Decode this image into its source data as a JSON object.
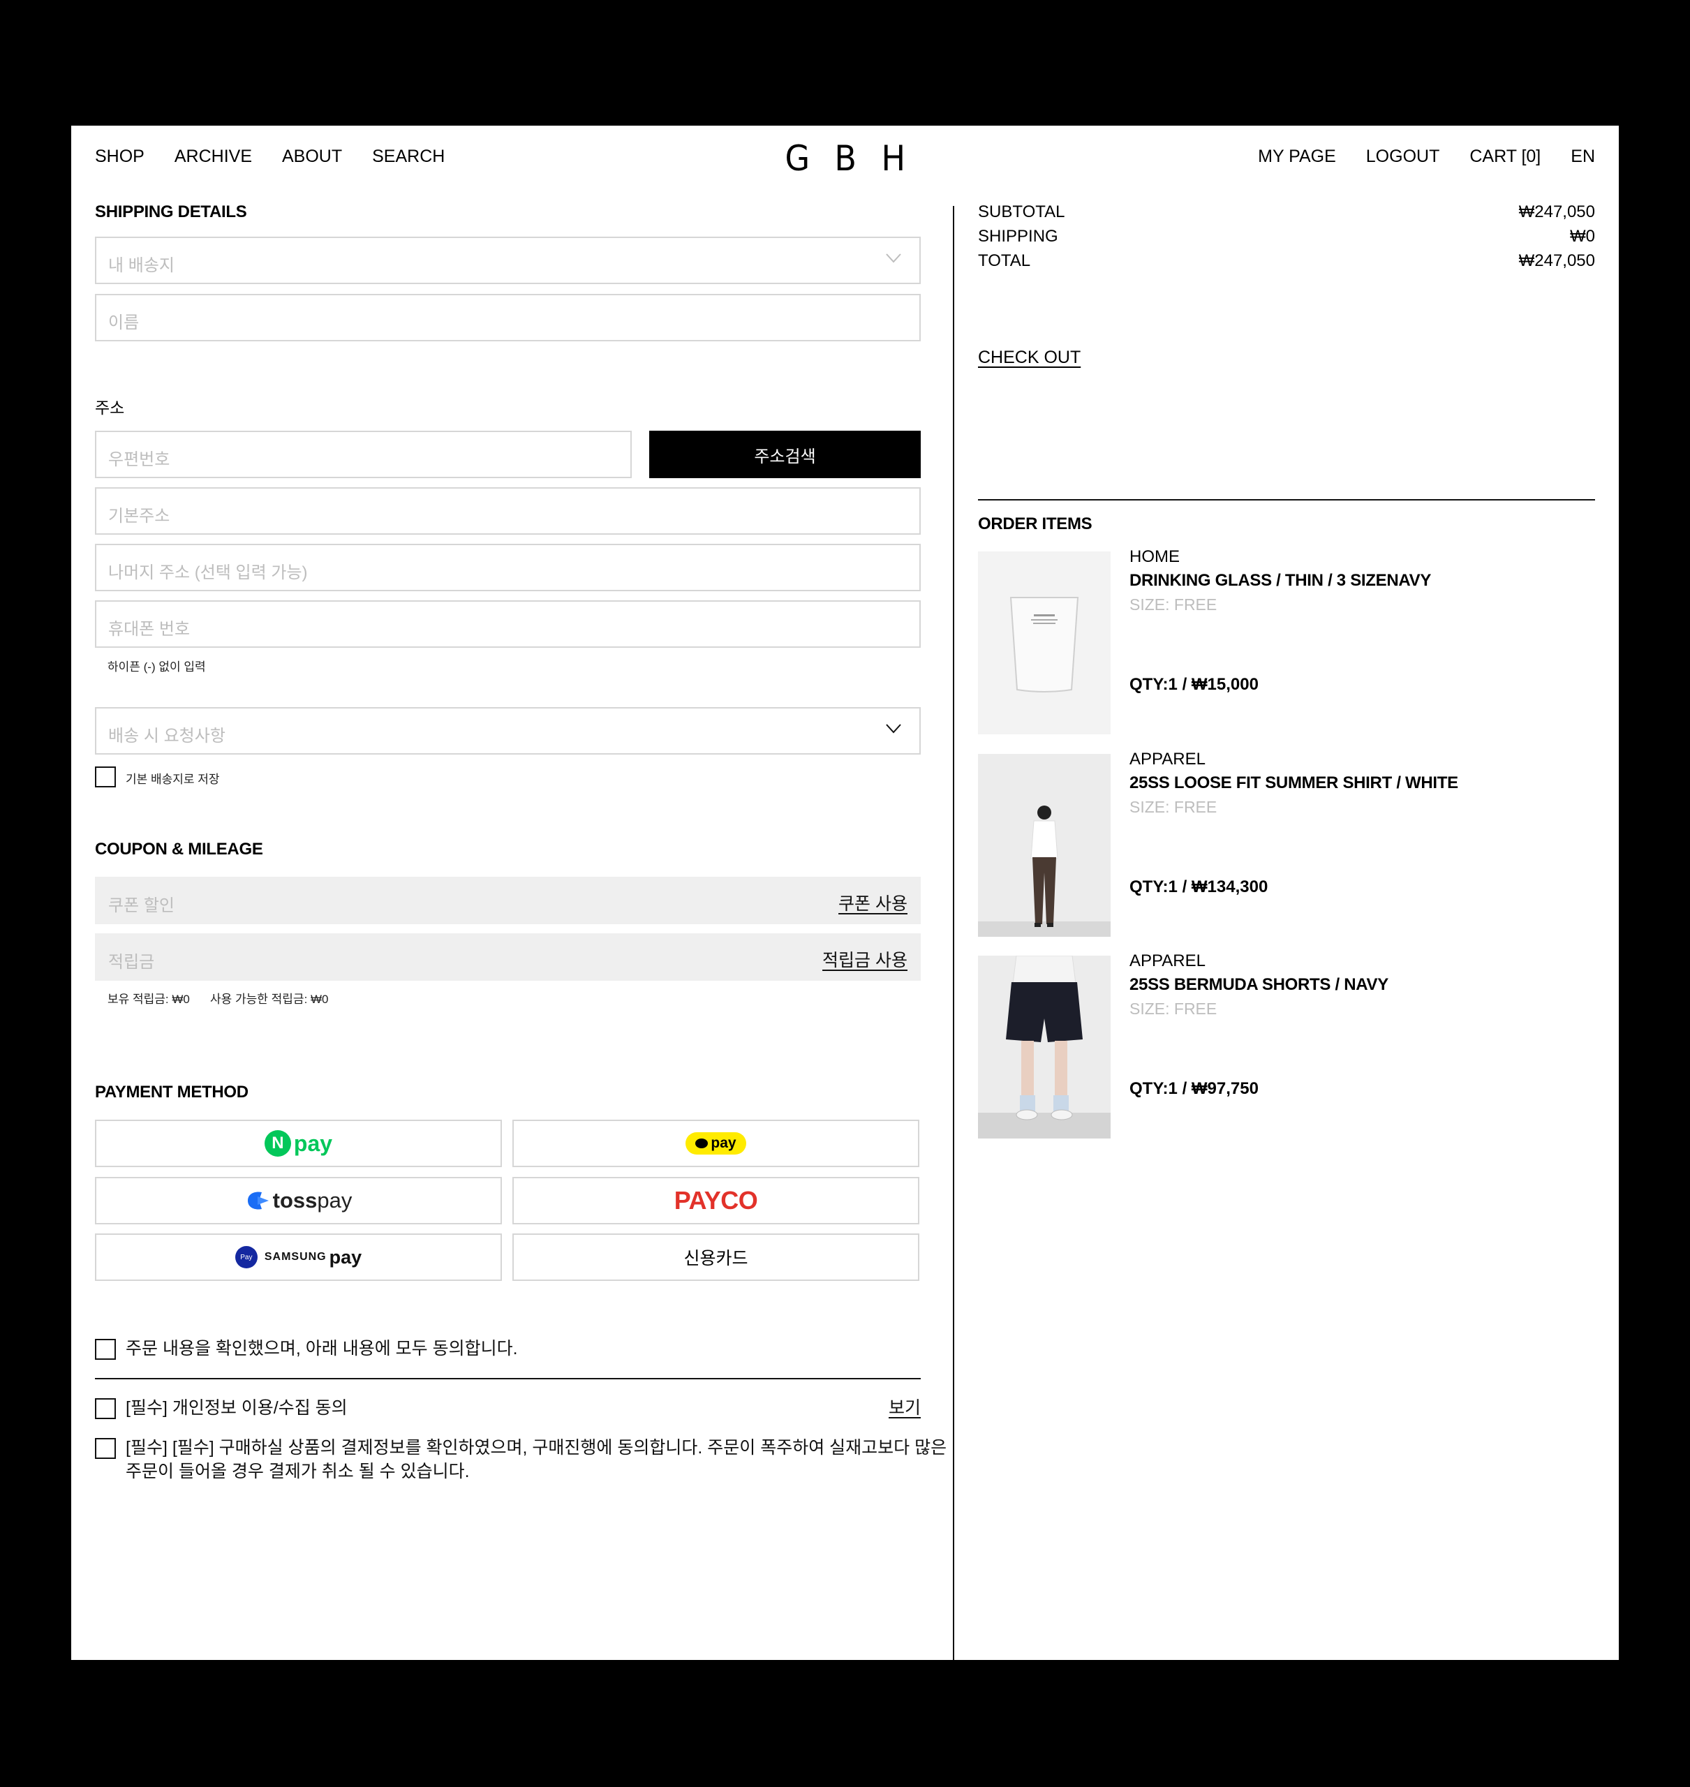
{
  "nav": {
    "left": [
      "SHOP",
      "ARCHIVE",
      "ABOUT",
      "SEARCH"
    ],
    "right": [
      "MY PAGE",
      "LOGOUT",
      "CART [0]",
      "EN"
    ]
  },
  "logo": [
    "G",
    "B",
    "H"
  ],
  "shipping": {
    "heading": "SHIPPING DETAILS",
    "address_book_placeholder": "내 배송지",
    "name_placeholder": "이름",
    "address_label": "주소",
    "postcode_placeholder": "우편번호",
    "search_button": "주소검색",
    "base_address_placeholder": "기본주소",
    "detail_address_placeholder": "나머지 주소 (선택 입력 가능)",
    "phone_placeholder": "휴대폰 번호",
    "phone_hint": "하이픈 (-) 없이 입력",
    "request_placeholder": "배송 시 요청사항",
    "save_default": "기본 배송지로 저장"
  },
  "coupon": {
    "heading": "COUPON & MILEAGE",
    "coupon_placeholder": "쿠폰 할인",
    "coupon_action": "쿠폰 사용",
    "mileage_placeholder": "적립금",
    "mileage_action": "적립금 사용",
    "owned": "보유 적립금: ₩0",
    "available": "사용 가능한 적립금: ₩0"
  },
  "payment": {
    "heading": "PAYMENT METHOD",
    "npay": "pay",
    "npay_badge": "N",
    "kakaopay": "pay",
    "tosspay_1": "toss",
    "tosspay_2": "pay",
    "payco": "PAYCO",
    "samsung_badge": "Pay",
    "samsung_1": "SAMSUNG",
    "samsung_2": "pay",
    "card": "신용카드"
  },
  "agreements": {
    "all": "주문 내용을 확인했으며, 아래 내용에 모두 동의합니다.",
    "privacy": "[필수] 개인정보 이용/수집 동의",
    "privacy_view": "보기",
    "purchase_1": "[필수] [필수] 구매하실 상품의 결제정보를 확인하였으며, 구매진행에 동의합니다. 주문이 폭주하여 실재고보다 많은",
    "purchase_2": "주문이 들어올 경우 결제가 취소 될 수 있습니다."
  },
  "summary": {
    "subtotal_label": "SUBTOTAL",
    "subtotal": "₩247,050",
    "shipping_label": "SHIPPING",
    "shipping": "₩0",
    "total_label": "TOTAL",
    "total": "₩247,050",
    "checkout": "CHECK OUT"
  },
  "order": {
    "heading": "ORDER ITEMS",
    "items": [
      {
        "category": "HOME",
        "name": "DRINKING GLASS / THIN / 3 SIZENAVY",
        "size": "SIZE: FREE",
        "qty": "QTY:1  /   ₩15,000"
      },
      {
        "category": "APPAREL",
        "name": "25SS LOOSE FIT SUMMER SHIRT / WHITE",
        "size": "SIZE: FREE",
        "qty": "QTY:1  /   ₩134,300"
      },
      {
        "category": "APPAREL",
        "name": "25SS BERMUDA SHORTS / NAVY",
        "size": "SIZE: FREE",
        "qty": "QTY:1  /   ₩97,750"
      }
    ]
  },
  "colors": {
    "npay_green": "#03c75a",
    "kakao_yellow": "#ffeb00",
    "toss_blue": "#1a6df5",
    "payco_red": "#e2322a",
    "samsung_blue": "#1428a0"
  }
}
